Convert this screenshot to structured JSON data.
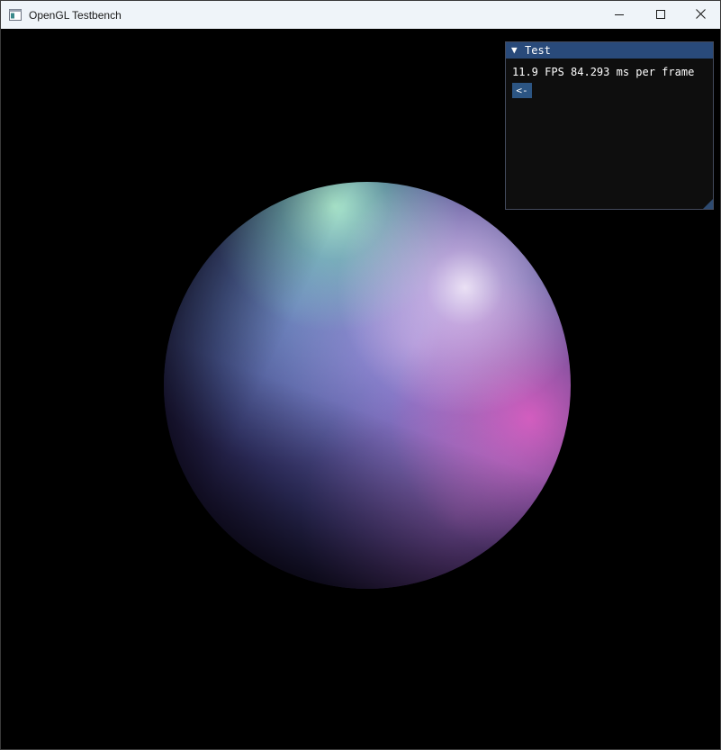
{
  "window": {
    "title": "OpenGL Testbench",
    "icons": {
      "app": "app-window-icon",
      "minimize": "minimize-icon",
      "maximize": "maximize-icon",
      "close": "close-icon"
    }
  },
  "imgui": {
    "title": "Test",
    "collapse_glyph": "▼",
    "stats_text": "11.9 FPS 84.293 ms per frame",
    "back_button_label": "<-",
    "colors": {
      "titlebar": "#294a7a",
      "button": "#2c5583",
      "background": "#0f0f0f"
    }
  }
}
